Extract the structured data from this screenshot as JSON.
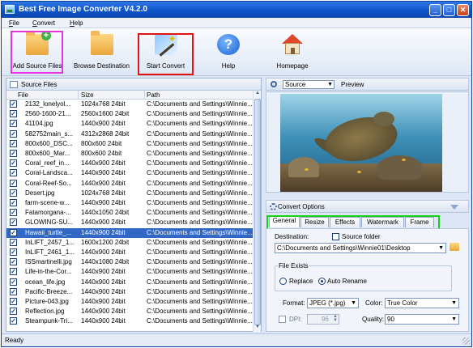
{
  "window": {
    "title": "Best Free Image Converter V4.2.0",
    "minimize": "_",
    "maximize": "□",
    "close": "✕"
  },
  "menu": {
    "file": "File",
    "file_key": "F",
    "file_rest": "ile",
    "convert": "Convert",
    "convert_key": "C",
    "convert_rest": "onvert",
    "help": "Help",
    "help_key": "H",
    "help_rest": "elp"
  },
  "toolbar": {
    "add_source": "Add Source Files",
    "browse": "Browse Destination",
    "start": "Start Convert",
    "help": "Help",
    "homepage": "Homepage"
  },
  "source_panel": {
    "title": "Source Files",
    "col_file": "File",
    "col_size": "Size",
    "col_path": "Path",
    "check_mark": "✓",
    "files": [
      {
        "name": "2132_lonelyol...",
        "size": "1024x768  24bit",
        "path": "C:\\Documents and Settings\\Winnie..."
      },
      {
        "name": "2560-1600-21...",
        "size": "2560x1600  24bit",
        "path": "C:\\Documents and Settings\\Winnie..."
      },
      {
        "name": "41104.jpg",
        "size": "1440x900  24bit",
        "path": "C:\\Documents and Settings\\Winnie..."
      },
      {
        "name": "582752main_s...",
        "size": "4312x2868  24bit",
        "path": "C:\\Documents and Settings\\Winnie..."
      },
      {
        "name": "800x600_DSC...",
        "size": "800x600  24bit",
        "path": "C:\\Documents and Settings\\Winnie..."
      },
      {
        "name": "800x600_Mar...",
        "size": "800x600  24bit",
        "path": "C:\\Documents and Settings\\Winnie..."
      },
      {
        "name": "Coral_reef_in...",
        "size": "1440x900  24bit",
        "path": "C:\\Documents and Settings\\Winnie..."
      },
      {
        "name": "Coral-Landsca...",
        "size": "1440x900  24bit",
        "path": "C:\\Documents and Settings\\Winnie..."
      },
      {
        "name": "Coral-Reef-So...",
        "size": "1440x900  24bit",
        "path": "C:\\Documents and Settings\\Winnie..."
      },
      {
        "name": "Desert.jpg",
        "size": "1024x768  24bit",
        "path": "C:\\Documents and Settings\\Winnie..."
      },
      {
        "name": "farm-scene-w...",
        "size": "1440x900  24bit",
        "path": "C:\\Documents and Settings\\Winnie..."
      },
      {
        "name": "Fatamorgana-...",
        "size": "1440x1050  24bit",
        "path": "C:\\Documents and Settings\\Winnie..."
      },
      {
        "name": "GLOWING-SU...",
        "size": "1440x900  24bit",
        "path": "C:\\Documents and Settings\\Winnie..."
      },
      {
        "name": "Hawaii_turtle_...",
        "size": "1440x900  24bit",
        "path": "C:\\Documents and Settings\\Winnie..."
      },
      {
        "name": "InLIFT_2457_1...",
        "size": "1600x1200  24bit",
        "path": "C:\\Documents and Settings\\Winnie..."
      },
      {
        "name": "InLIFT_2461_1...",
        "size": "1440x900  24bit",
        "path": "C:\\Documents and Settings\\Winnie..."
      },
      {
        "name": "ISSmartinelli.jpg",
        "size": "1440x1080  24bit",
        "path": "C:\\Documents and Settings\\Winnie..."
      },
      {
        "name": "Life-in-the-Cor...",
        "size": "1440x900  24bit",
        "path": "C:\\Documents and Settings\\Winnie..."
      },
      {
        "name": "ocean_life.jpg",
        "size": "1440x900  24bit",
        "path": "C:\\Documents and Settings\\Winnie..."
      },
      {
        "name": "Pacific-Breeze...",
        "size": "1440x900  24bit",
        "path": "C:\\Documents and Settings\\Winnie..."
      },
      {
        "name": "Picture-043.jpg",
        "size": "1440x900  24bit",
        "path": "C:\\Documents and Settings\\Winnie..."
      },
      {
        "name": "Reflection.jpg",
        "size": "1440x900  24bit",
        "path": "C:\\Documents and Settings\\Winnie..."
      },
      {
        "name": "Steampunk-Tri...",
        "size": "1440x900  24bit",
        "path": "C:\\Documents and Settings\\Winnie..."
      }
    ]
  },
  "preview": {
    "source_select": "Source",
    "label": "Preview"
  },
  "options": {
    "title": "Convert Options",
    "tabs": [
      "General",
      "Resize",
      "Effects",
      "Watermark",
      "Frame"
    ],
    "destination_label": "Destination:",
    "source_folder_label": "Source folder",
    "destination_value": "C:\\Documents and Settings\\Winnie01\\Desktop",
    "file_exists_label": "File Exists",
    "replace_label": "Replace",
    "auto_rename_label": "Auto Rename",
    "format_label": "Format:",
    "format_value": "JPEG (*.jpg)",
    "color_label": "Color:",
    "color_value": "True Color",
    "dpi_label": "DPI:",
    "dpi_value": "96",
    "quality_label": "Quality:",
    "quality_value": "90"
  },
  "status": {
    "text": "Ready"
  },
  "colors": {
    "selected_row": "#3168c6",
    "highlight_add": "#e634e0",
    "highlight_start": "#e51212",
    "highlight_tabs": "#16d016"
  }
}
